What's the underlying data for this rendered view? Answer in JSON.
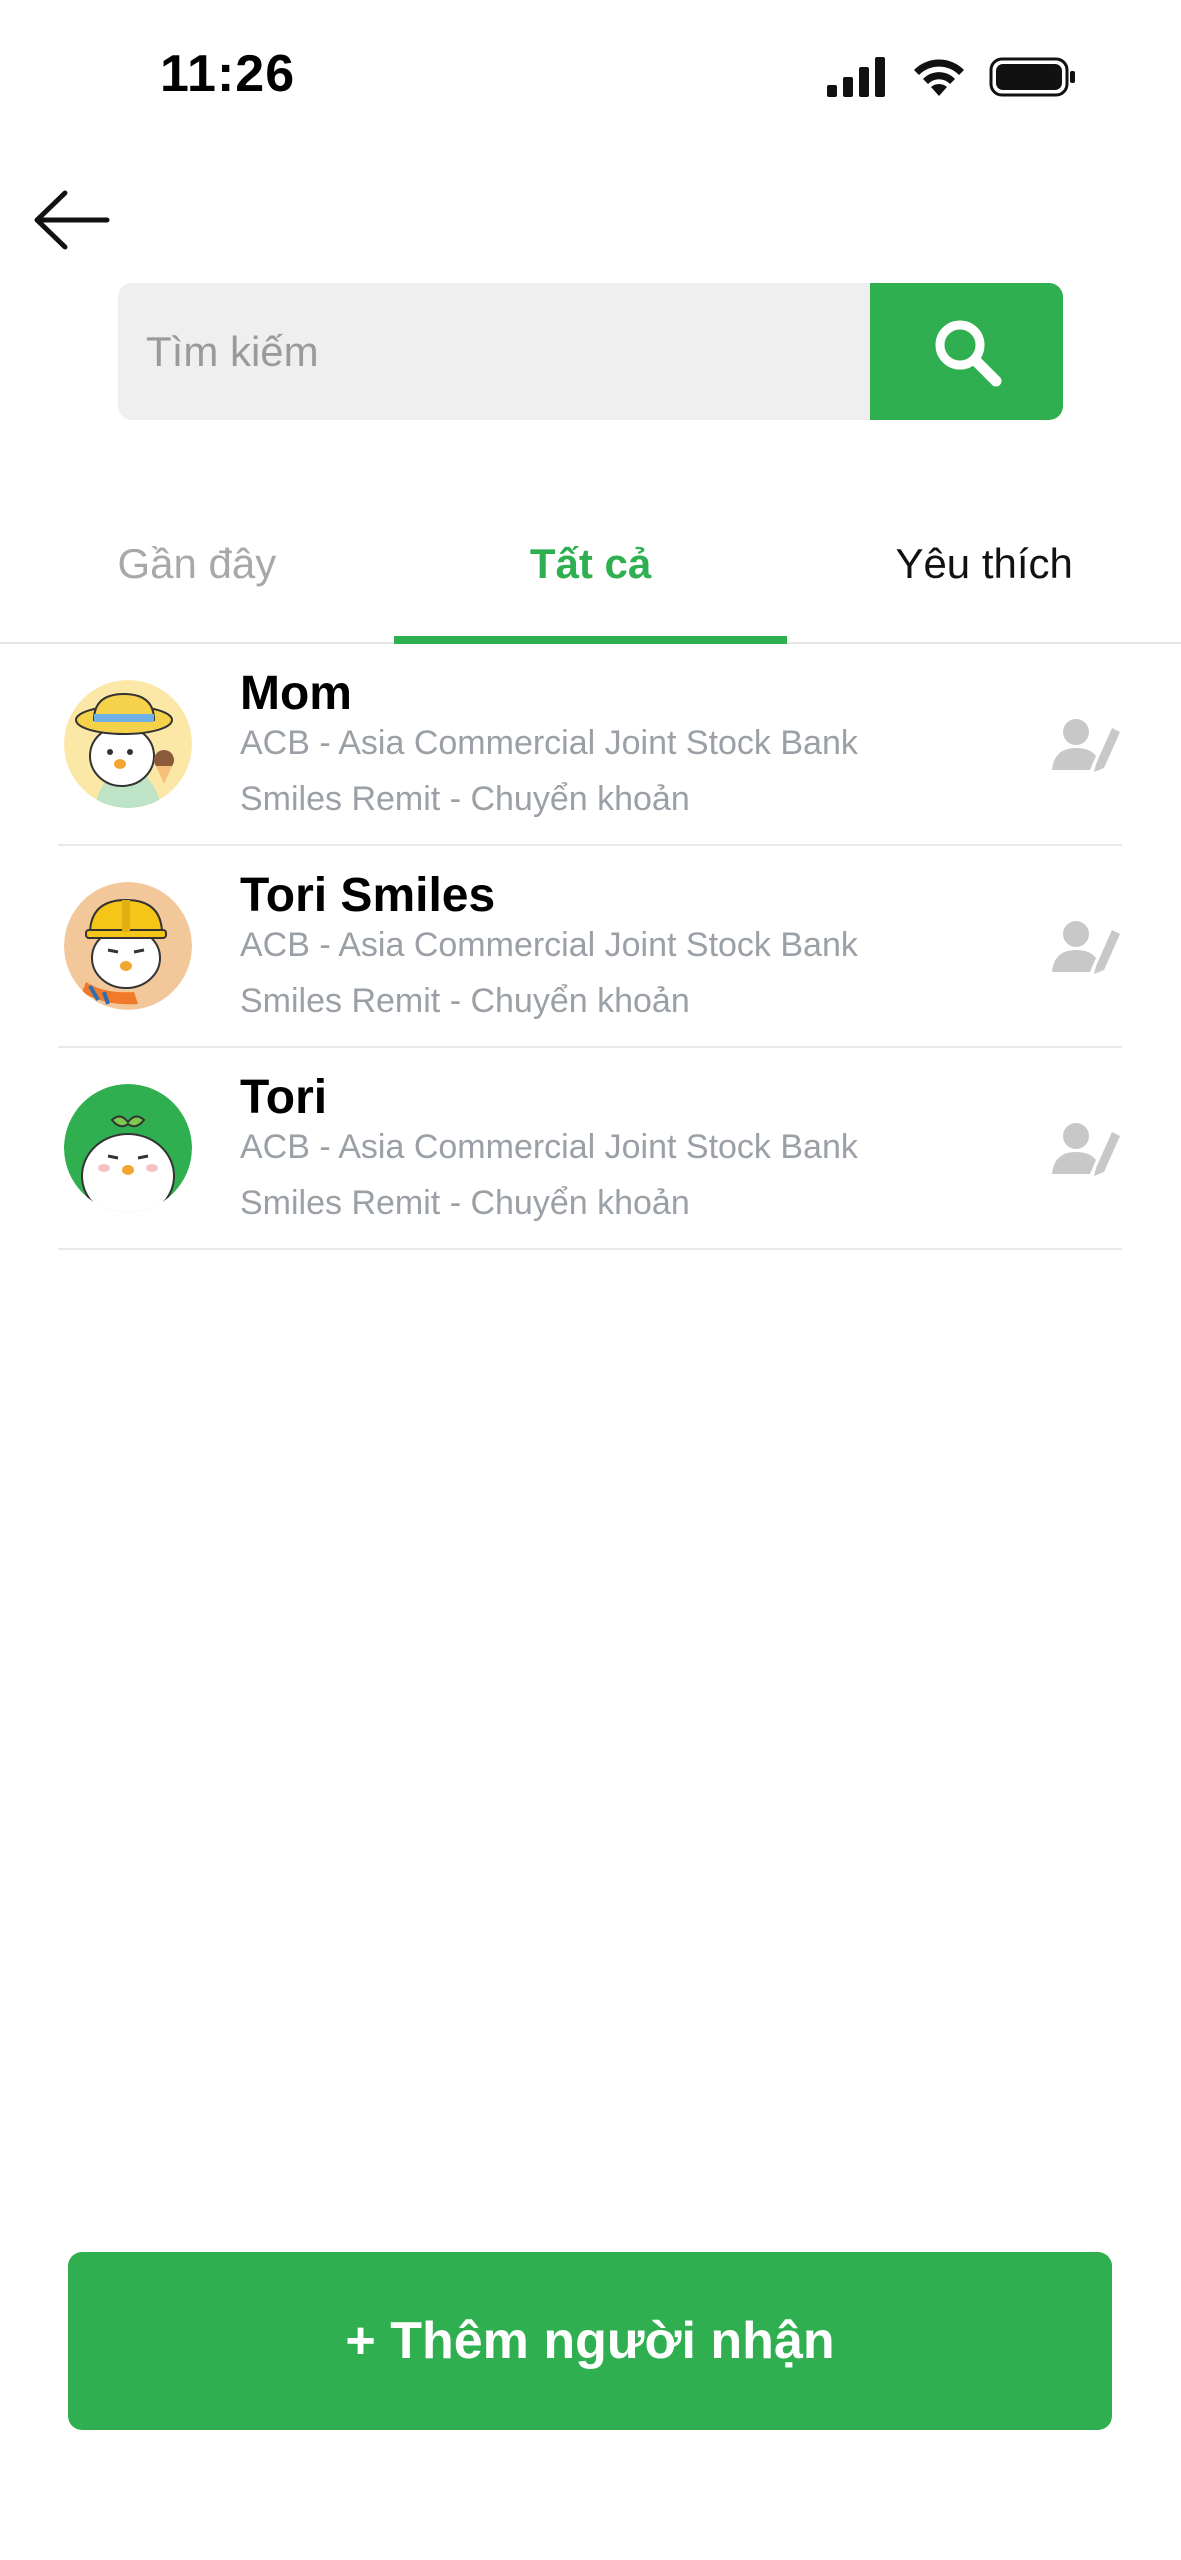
{
  "status_bar": {
    "time": "11:26"
  },
  "search": {
    "placeholder": "Tìm kiếm"
  },
  "tabs": [
    {
      "label": "Gần đây",
      "active": false
    },
    {
      "label": "Tất cả",
      "active": true
    },
    {
      "label": "Yêu thích",
      "active": false
    }
  ],
  "recipients": [
    {
      "name": "Mom",
      "bank": "ACB - Asia Commercial Joint Stock Bank",
      "service": "Smiles Remit - Chuyển khoản",
      "avatar_bg": "#fbe7a6"
    },
    {
      "name": "Tori Smiles",
      "bank": "ACB - Asia Commercial Joint Stock Bank",
      "service": "Smiles Remit - Chuyển khoản",
      "avatar_bg": "#f2c79a"
    },
    {
      "name": "Tori",
      "bank": "ACB - Asia Commercial Joint Stock Bank",
      "service": "Smiles Remit - Chuyển khoản",
      "avatar_bg": "#2faf4f"
    }
  ],
  "add_button": {
    "label": "+ Thêm người nhận"
  },
  "colors": {
    "accent": "#2faf4f",
    "muted": "#9aa0a6",
    "search_bg": "#efefef"
  },
  "icons": {
    "back": "arrow-left-icon",
    "search": "search-icon",
    "edit": "user-edit-icon"
  }
}
